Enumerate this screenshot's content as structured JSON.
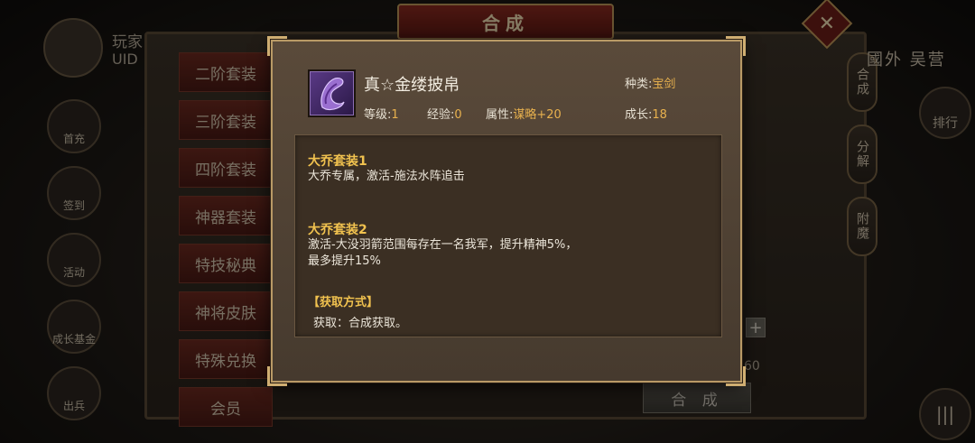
{
  "window": {
    "title": "合成",
    "close_glyph": "✕"
  },
  "player": {
    "name": "玩家",
    "uid": "UID"
  },
  "left_nav": [
    {
      "label": "首充",
      "icon": "gift-icon"
    },
    {
      "label": "签到",
      "icon": "calendar-icon"
    },
    {
      "label": "活动",
      "icon": "flag-icon"
    },
    {
      "label": "成长基金",
      "icon": "coin-icon"
    },
    {
      "label": "出兵",
      "icon": "sword-icon"
    }
  ],
  "category_menu": [
    {
      "label": "二阶套装"
    },
    {
      "label": "三阶套装"
    },
    {
      "label": "四阶套装"
    },
    {
      "label": "神器套装"
    },
    {
      "label": "特技秘典"
    },
    {
      "label": "神将皮肤"
    },
    {
      "label": "特殊兑换"
    },
    {
      "label": "会员"
    }
  ],
  "right_tabs": [
    {
      "label": "合成"
    },
    {
      "label": "分解"
    },
    {
      "label": "附魔"
    }
  ],
  "top_right": {
    "text": "國外 吴营",
    "ranking_label": "排行",
    "menu_glyph": "|||"
  },
  "merge_panel": {
    "merge_button_label": "合 成",
    "plus_glyph": "+",
    "count_value": "60"
  },
  "item": {
    "name": "真☆金缕披帛",
    "category_label": "种类:",
    "category_value": "宝剑",
    "level_label": "等级:",
    "level_value": "1",
    "exp_label": "经验:",
    "exp_value": "0",
    "attr_label": "属性:",
    "attr_value": "谋略+20",
    "growth_label": "成长:",
    "growth_value": "18",
    "icon": "shawl-icon",
    "icon_color": "#7a4fb0"
  },
  "set_effects": [
    {
      "title": "大乔套装1",
      "text": "大乔专属，激活-施法水阵追击"
    },
    {
      "title": "大乔套装2",
      "text": "激活-大没羽箭范围每存在一名我军，提升精神5%，",
      "text2": "最多提升15%"
    }
  ],
  "acquisition": {
    "title": "【获取方式】",
    "text": "获取：合成获取。"
  },
  "colors": {
    "accent_gold": "#f1c24f",
    "value_orange": "#e8b14e",
    "modal_border": "#b99a66",
    "menu_red": "#6e2a20"
  }
}
